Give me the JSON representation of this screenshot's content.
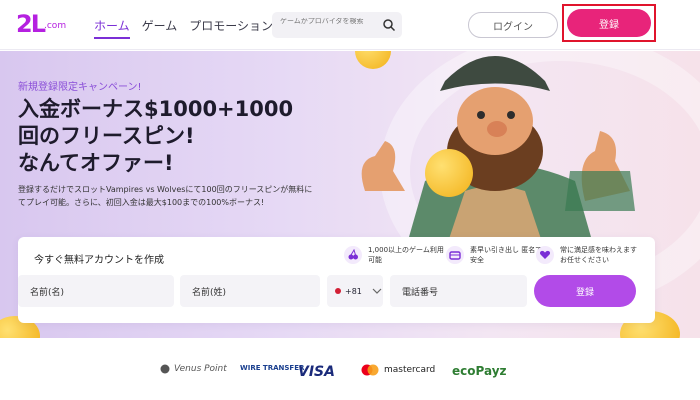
{
  "header": {
    "logo_mark": "2L",
    "logo_domain": ".com",
    "nav": [
      "ホーム",
      "ゲーム",
      "プロモーション"
    ],
    "search_placeholder": "ゲームかプロバイダを検索",
    "login_label": "ログイン",
    "register_label": "登録"
  },
  "hero": {
    "promo_tag": "新規登録限定キャンペーン!",
    "headline": [
      "入金ボーナス$1000+1000",
      "回のフリースピン!",
      "なんてオファー!"
    ],
    "description": "登録するだけでスロットVampires vs Wolvesにて100回のフリースピンが無料にてプレイ可能。さらに、初回入金は最大$100までの100%ボーナス!"
  },
  "signup": {
    "title": "今すぐ無料アカウントを作成",
    "features": [
      {
        "icon": "cherry-icon",
        "text": "1,000以上のゲーム利用可能"
      },
      {
        "icon": "wallet-icon",
        "text": "素早い引き出し 匿名で安全"
      },
      {
        "icon": "heart-icon",
        "text": "常に満足感を味わえます お任せください"
      }
    ],
    "first_name_placeholder": "名前(名)",
    "last_name_placeholder": "名前(姓)",
    "country_code": "+81",
    "phone_placeholder": "電話番号",
    "submit_label": "登録"
  },
  "payments": [
    "Venus Point",
    "WIRE TRANSFER",
    "VISA",
    "mastercard",
    "ecoPayz"
  ],
  "colors": {
    "brand": "#b520e0",
    "accent_pink": "#e8247a",
    "highlight_outline": "#e0142c",
    "submit_purple": "#b24be8"
  }
}
